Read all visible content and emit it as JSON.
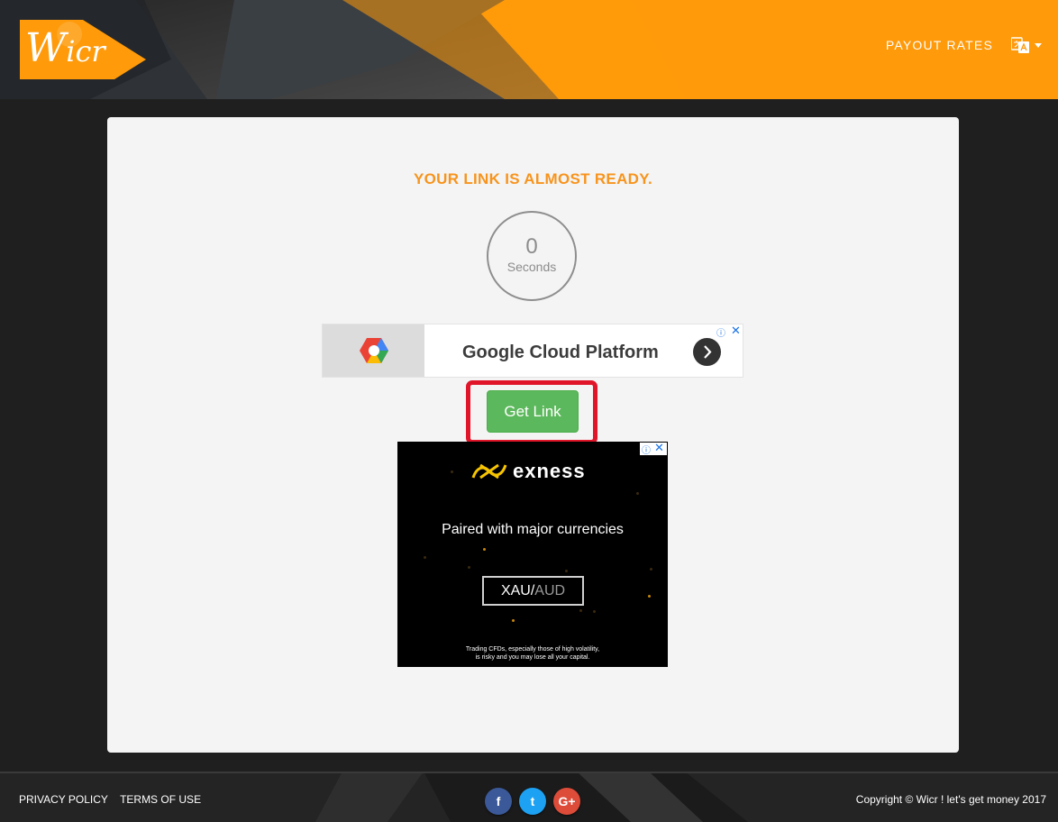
{
  "header": {
    "logo_text_initial": "W",
    "logo_text_rest": "icr",
    "nav_payout": "PAYOUT RATES"
  },
  "main": {
    "ready_text": "YOUR LINK IS ALMOST READY.",
    "timer_value": "0",
    "timer_label": "Seconds",
    "get_link_label": "Get Link"
  },
  "ads": {
    "banner_title": "Google Cloud Platform",
    "adchoices_glyph": "ⓘ",
    "close_glyph": "✕",
    "exness_brand": "exness",
    "exness_tagline": "Paired with major currencies",
    "exness_pair_base": "XAU/",
    "exness_pair_quote": "AUD",
    "exness_disclaimer_1": "Trading CFDs, especially those of high volatility,",
    "exness_disclaimer_2": "is risky and you may lose all your capital."
  },
  "footer": {
    "privacy": "PRIVACY POLICY",
    "terms": "TERMS OF USE",
    "copyright": "Copyright © Wicr ! let's get money 2017",
    "social": [
      {
        "name": "facebook-icon",
        "glyph": "f",
        "color": "#3b5998"
      },
      {
        "name": "twitter-icon",
        "glyph": "t",
        "color": "#1da1f2"
      },
      {
        "name": "google-plus-icon",
        "glyph": "G+",
        "color": "#dd4b39"
      }
    ]
  },
  "colors": {
    "header_orange": "#ff9a0a",
    "accent_orange": "#f7941d",
    "button_green": "#5cb85c",
    "highlight_red": "#e0152a"
  }
}
